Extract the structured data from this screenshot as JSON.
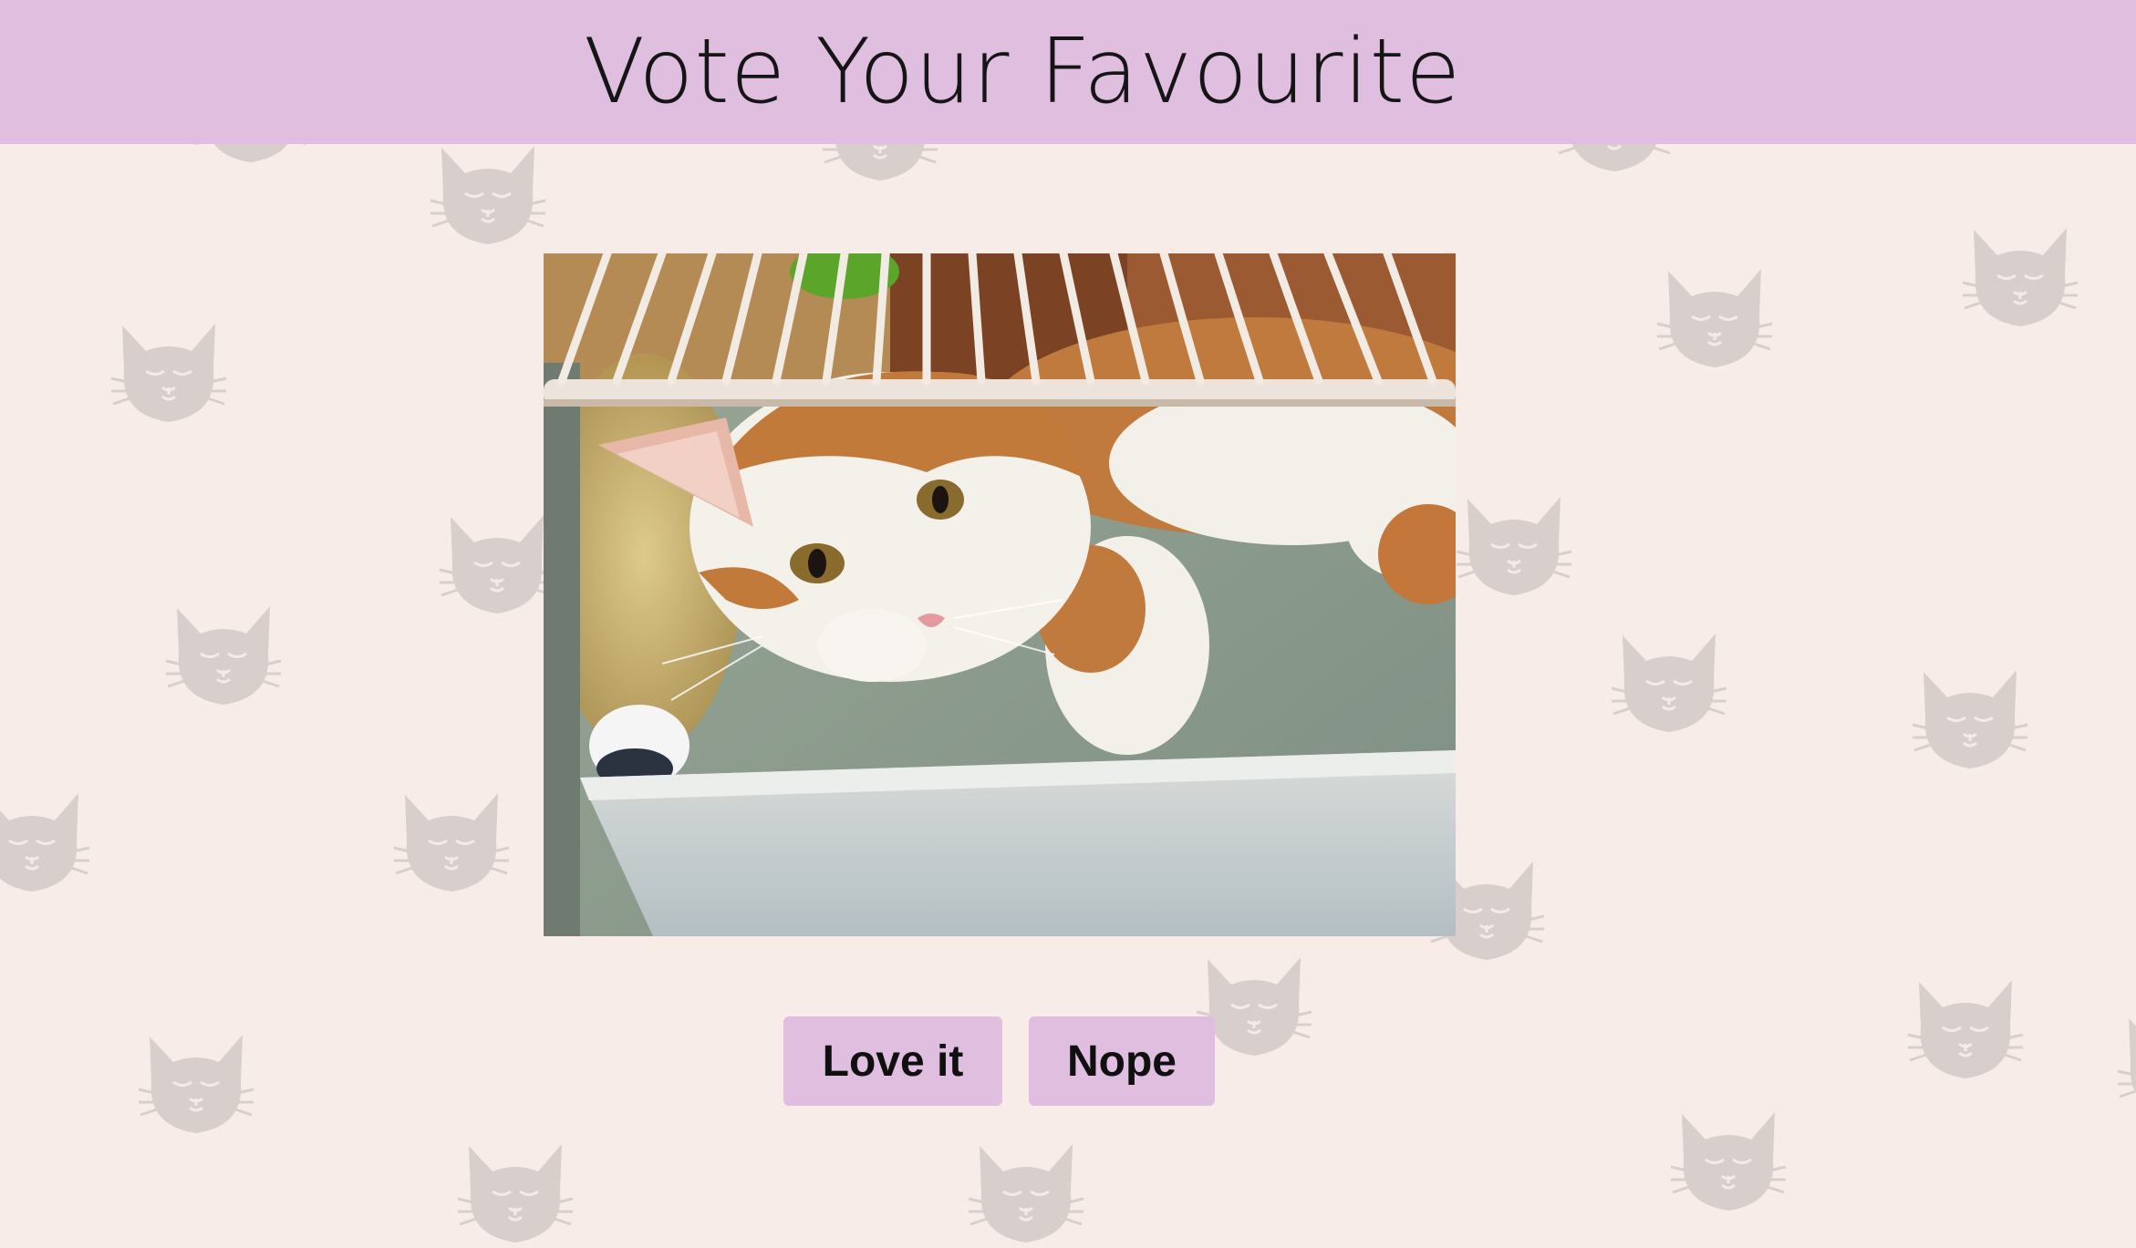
{
  "header": {
    "title": "Vote Your Favourite",
    "background_color": "#dfbedf"
  },
  "background": {
    "color": "#f7ece8",
    "pattern_icon": "cat-face-icon"
  },
  "photo": {
    "subject": "cat-photo",
    "alt": "Orange and white cat lying inside a refrigerator under a wire shelf"
  },
  "actions": {
    "love_label": "Love it",
    "nope_label": "Nope",
    "button_color": "#dfbedf"
  }
}
